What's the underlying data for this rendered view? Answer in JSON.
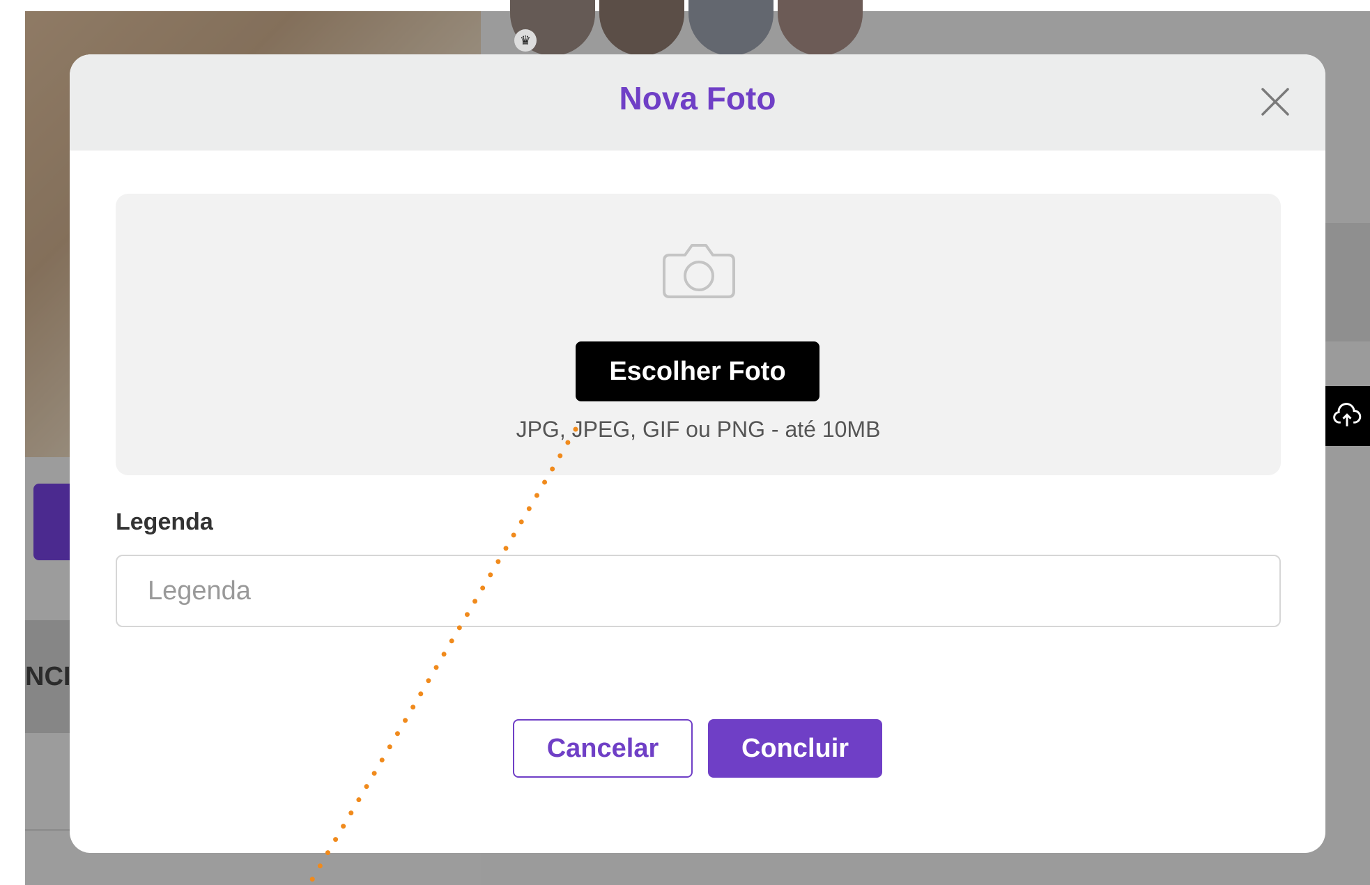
{
  "modal": {
    "title": "Nova Foto",
    "choose_photo_label": "Escolher Foto",
    "formats_hint": "JPG, JPEG, GIF ou PNG - até 10MB",
    "caption_label": "Legenda",
    "caption_placeholder": "Legenda",
    "caption_value": "",
    "cancel_label": "Cancelar",
    "done_label": "Concluir"
  },
  "background": {
    "tab_text_fragment": "NCI/"
  },
  "colors": {
    "accent": "#6f3fc6",
    "header_bg": "#eceded",
    "dropzone_bg": "#f2f2f2",
    "overlay_bg": "#9b9b9b",
    "annotation": "#f08a1c"
  },
  "icons": {
    "close": "close-icon",
    "camera": "camera-icon",
    "upload": "cloud-upload-icon",
    "crown": "crown-icon"
  }
}
